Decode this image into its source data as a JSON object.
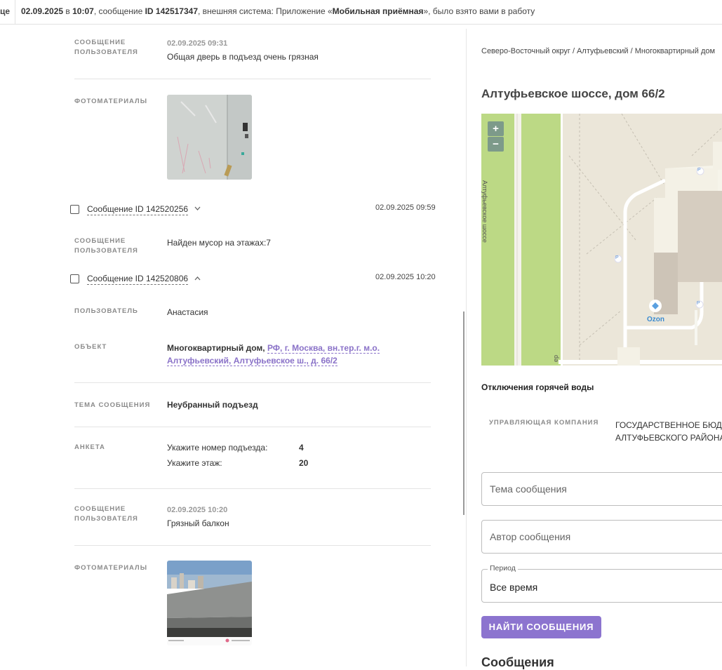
{
  "topbar": {
    "cut_left": "це",
    "date": "02.09.2025",
    "in": " в ",
    "time": "10:07",
    "text1": ", сообщение ",
    "msg_id": "ID 142517347",
    "text2": ", внешняя система: Приложение «",
    "app": "Мобильная приёмная",
    "text3": "», было взято вами в работу"
  },
  "left": {
    "block1": {
      "label": "Сообщение пользователя",
      "date": "02.09.2025 09:31",
      "text": "Общая дверь в подъезд очень грязная",
      "photos_label": "Фотоматериалы"
    },
    "message2": {
      "id": "Сообщение ID 142520256",
      "date": "02.09.2025 09:59",
      "label": "Сообщение пользователя",
      "text": "Найден мусор на этажах:7"
    },
    "message3": {
      "id": "Сообщение ID 142520806",
      "date": "02.09.2025 10:20",
      "user_label": "Пользователь",
      "user": "Анастасия",
      "object_label": "Объект",
      "object_type": "Многоквартирный дом,",
      "object_link1": "РФ, г. Москва, вн.тер.г. м.о.",
      "object_link2": "Алтуфьевский, Алтуфьевское ш., д. 66/2",
      "topic_label": "Тема сообщения",
      "topic": "Неубранный подъезд",
      "survey_label": "Анкета",
      "survey": [
        {
          "q": "Укажите номер подъезда:",
          "a": "4"
        },
        {
          "q": "Укажите этаж:",
          "a": "20"
        }
      ],
      "msg_label": "Сообщение пользователя",
      "msg_date": "02.09.2025 10:20",
      "msg_text": "Грязный балкон",
      "photos_label": "Фотоматериалы"
    }
  },
  "right": {
    "breadcrumb": "Северо-Восточный округ / Алтуфьевский / Многоквартирный дом",
    "address": "Алтуфьевское шоссе, дом 66/2",
    "map": {
      "zoom_in": "+",
      "zoom_out": "−",
      "poi": "Ozon",
      "parking": "P",
      "road_label": "Алтуфьевское шоссе",
      "street_bottom": "ер"
    },
    "hot_water": "Отключения горячей воды",
    "mc_label": "Управляющая компания",
    "mc_value1": "ГОСУДАРСТВЕННОЕ БЮДЖ",
    "mc_value2": "АЛТУФЬЕВСКОГО РАЙОНА",
    "topic_placeholder": "Тема сообщения",
    "author_placeholder": "Автор сообщения",
    "period_label": "Период",
    "period_value": "Все время",
    "search_button": "Найти сообщения",
    "messages_title": "Сообщения"
  },
  "colors": {
    "accent": "#8c74cf",
    "link": "#8a72c8",
    "map_road_green": "#bcd985"
  }
}
